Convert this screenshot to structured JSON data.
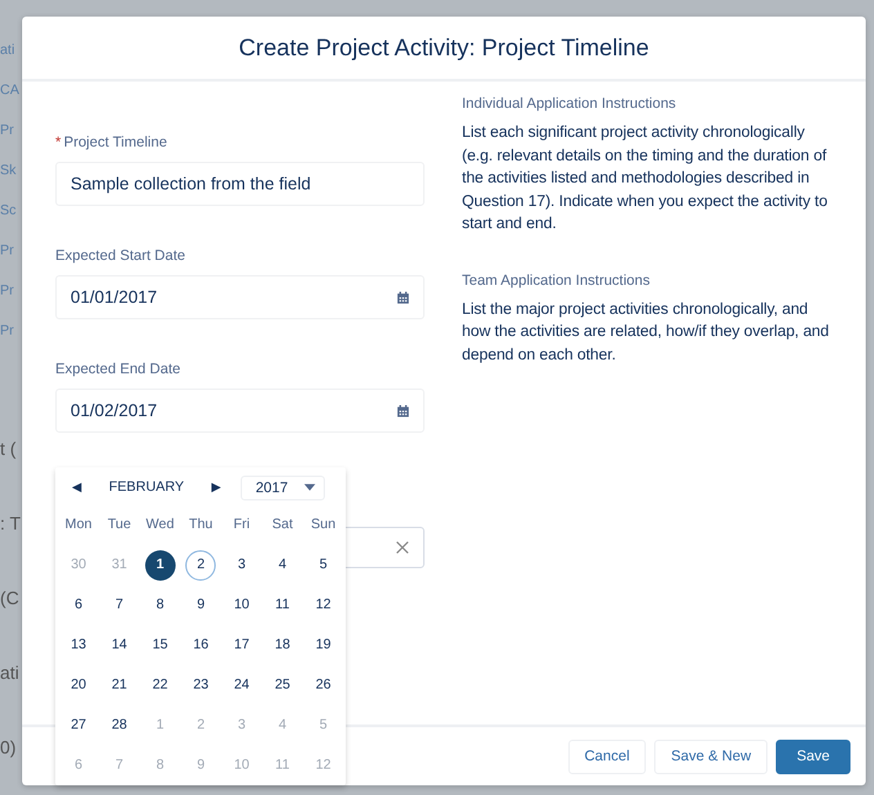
{
  "backdrop": {
    "links": [
      "ati",
      "CA",
      "Pr",
      "Sk",
      "Sc",
      "Pr",
      "Pr",
      "Pr"
    ],
    "labels": [
      "t (",
      ": T",
      "(C",
      "ati",
      "0)"
    ]
  },
  "modal": {
    "title": "Create Project Activity: Project Timeline",
    "fields": [
      {
        "label": "Project Timeline",
        "marker": "*",
        "value": "Sample collection from the field",
        "kind": "text"
      },
      {
        "label": "Expected Start Date",
        "value": "01/01/2017",
        "kind": "date"
      },
      {
        "label": "Expected End Date",
        "value": "01/02/2017",
        "kind": "date"
      }
    ],
    "hidden_field": {
      "kind": "clearable"
    },
    "instructions": [
      {
        "heading": "Individual Application Instructions",
        "text": "List each significant project activity chronologically (e.g. relevant details on the timing and the duration of the activities listed and methodologies described in Question 17). Indicate when you expect the activity to start and end."
      },
      {
        "heading": "Team Application Instructions",
        "text": "List the major project activities chronologically, and how the activities are related, how/if they overlap, and depend on each other."
      }
    ],
    "buttons": [
      {
        "label": "Cancel",
        "kind": "neutral"
      },
      {
        "label": "Save & New",
        "kind": "neutral"
      },
      {
        "label": "Save",
        "kind": "brand"
      }
    ]
  },
  "calendar": {
    "prev": "◀",
    "month": "FEBRUARY",
    "next": "▶",
    "year": "2017",
    "weekdays": [
      "Mon",
      "Tue",
      "Wed",
      "Thu",
      "Fri",
      "Sat",
      "Sun"
    ],
    "days": [
      {
        "label": "30",
        "outside": true,
        "selected": false,
        "today": false
      },
      {
        "label": "31",
        "outside": true,
        "selected": false,
        "today": false
      },
      {
        "label": "1",
        "outside": false,
        "selected": true,
        "today": false
      },
      {
        "label": "2",
        "outside": false,
        "selected": false,
        "today": true
      },
      {
        "label": "3",
        "outside": false,
        "selected": false,
        "today": false
      },
      {
        "label": "4",
        "outside": false,
        "selected": false,
        "today": false
      },
      {
        "label": "5",
        "outside": false,
        "selected": false,
        "today": false
      },
      {
        "label": "6",
        "outside": false,
        "selected": false,
        "today": false
      },
      {
        "label": "7",
        "outside": false,
        "selected": false,
        "today": false
      },
      {
        "label": "8",
        "outside": false,
        "selected": false,
        "today": false
      },
      {
        "label": "9",
        "outside": false,
        "selected": false,
        "today": false
      },
      {
        "label": "10",
        "outside": false,
        "selected": false,
        "today": false
      },
      {
        "label": "11",
        "outside": false,
        "selected": false,
        "today": false
      },
      {
        "label": "12",
        "outside": false,
        "selected": false,
        "today": false
      },
      {
        "label": "13",
        "outside": false,
        "selected": false,
        "today": false
      },
      {
        "label": "14",
        "outside": false,
        "selected": false,
        "today": false
      },
      {
        "label": "15",
        "outside": false,
        "selected": false,
        "today": false
      },
      {
        "label": "16",
        "outside": false,
        "selected": false,
        "today": false
      },
      {
        "label": "17",
        "outside": false,
        "selected": false,
        "today": false
      },
      {
        "label": "18",
        "outside": false,
        "selected": false,
        "today": false
      },
      {
        "label": "19",
        "outside": false,
        "selected": false,
        "today": false
      },
      {
        "label": "20",
        "outside": false,
        "selected": false,
        "today": false
      },
      {
        "label": "21",
        "outside": false,
        "selected": false,
        "today": false
      },
      {
        "label": "22",
        "outside": false,
        "selected": false,
        "today": false
      },
      {
        "label": "23",
        "outside": false,
        "selected": false,
        "today": false
      },
      {
        "label": "24",
        "outside": false,
        "selected": false,
        "today": false
      },
      {
        "label": "25",
        "outside": false,
        "selected": false,
        "today": false
      },
      {
        "label": "26",
        "outside": false,
        "selected": false,
        "today": false
      },
      {
        "label": "27",
        "outside": false,
        "selected": false,
        "today": false
      },
      {
        "label": "28",
        "outside": false,
        "selected": false,
        "today": false
      },
      {
        "label": "1",
        "outside": true,
        "selected": false,
        "today": false
      },
      {
        "label": "2",
        "outside": true,
        "selected": false,
        "today": false
      },
      {
        "label": "3",
        "outside": true,
        "selected": false,
        "today": false
      },
      {
        "label": "4",
        "outside": true,
        "selected": false,
        "today": false
      },
      {
        "label": "5",
        "outside": true,
        "selected": false,
        "today": false
      },
      {
        "label": "6",
        "outside": true,
        "selected": false,
        "today": false
      },
      {
        "label": "7",
        "outside": true,
        "selected": false,
        "today": false
      },
      {
        "label": "8",
        "outside": true,
        "selected": false,
        "today": false
      },
      {
        "label": "9",
        "outside": true,
        "selected": false,
        "today": false
      },
      {
        "label": "10",
        "outside": true,
        "selected": false,
        "today": false
      },
      {
        "label": "11",
        "outside": true,
        "selected": false,
        "today": false
      },
      {
        "label": "12",
        "outside": true,
        "selected": false,
        "today": false
      }
    ]
  }
}
